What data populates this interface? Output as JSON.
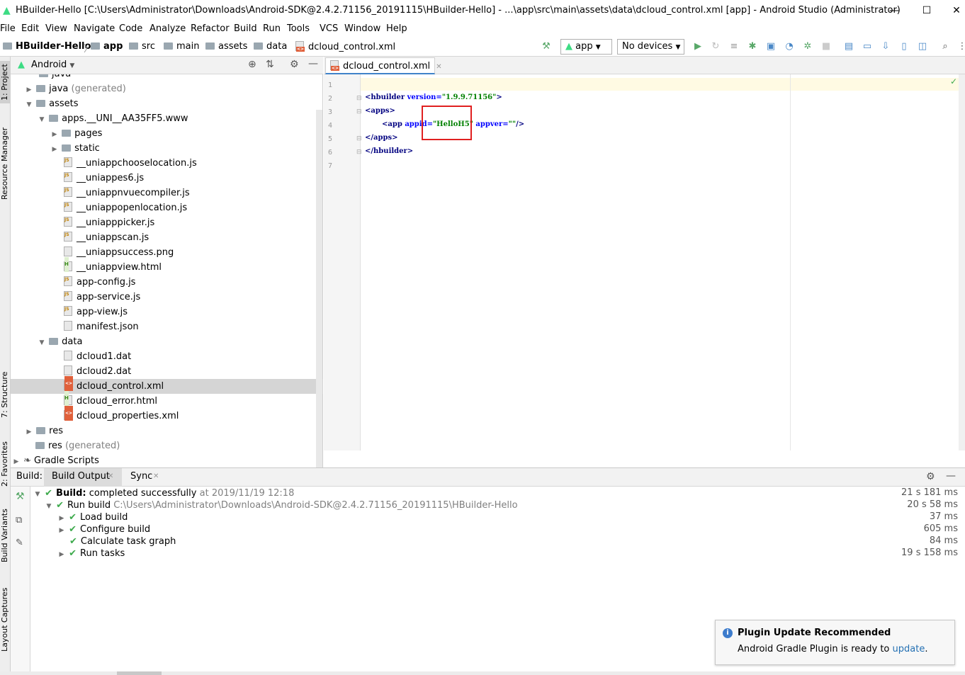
{
  "window": {
    "title": "HBuilder-Hello [C:\\Users\\Administrator\\Downloads\\Android-SDK@2.4.2.71156_20191115\\HBuilder-Hello] - ...\\app\\src\\main\\assets\\data\\dcloud_control.xml [app] - Android Studio (Administrator)",
    "minimize": "—",
    "maximize": "☐",
    "close": "✕"
  },
  "menu": [
    "File",
    "Edit",
    "View",
    "Navigate",
    "Code",
    "Analyze",
    "Refactor",
    "Build",
    "Run",
    "Tools",
    "VCS",
    "Window",
    "Help"
  ],
  "breadcrumb": [
    "HBuilder-Hello",
    "app",
    "src",
    "main",
    "assets",
    "data",
    "dcloud_control.xml"
  ],
  "toolbar": {
    "config": "app",
    "device": "No devices"
  },
  "left_tabs": [
    "1: Project",
    "Resource Manager",
    "7: Structure",
    "2: Favorites",
    "Build Variants",
    "Layout Captures"
  ],
  "project": {
    "view_label": "Android",
    "tree": [
      {
        "label": "java",
        "extra": ""
      },
      {
        "label": "java",
        "extra": "(generated)"
      },
      {
        "label": "assets",
        "extra": ""
      },
      {
        "label": "apps.__UNI__AA35FF5.www",
        "extra": ""
      },
      {
        "label": "pages",
        "extra": ""
      },
      {
        "label": "static",
        "extra": ""
      },
      {
        "label": "__uniappchooselocation.js",
        "extra": ""
      },
      {
        "label": "__uniappes6.js",
        "extra": ""
      },
      {
        "label": "__uniappnvuecompiler.js",
        "extra": ""
      },
      {
        "label": "__uniappopenlocation.js",
        "extra": ""
      },
      {
        "label": "__uniapppicker.js",
        "extra": ""
      },
      {
        "label": "__uniappscan.js",
        "extra": ""
      },
      {
        "label": "__uniappsuccess.png",
        "extra": ""
      },
      {
        "label": "__uniappview.html",
        "extra": ""
      },
      {
        "label": "app-config.js",
        "extra": ""
      },
      {
        "label": "app-service.js",
        "extra": ""
      },
      {
        "label": "app-view.js",
        "extra": ""
      },
      {
        "label": "manifest.json",
        "extra": ""
      },
      {
        "label": "data",
        "extra": ""
      },
      {
        "label": "dcloud1.dat",
        "extra": ""
      },
      {
        "label": "dcloud2.dat",
        "extra": ""
      },
      {
        "label": "dcloud_control.xml",
        "extra": ""
      },
      {
        "label": "dcloud_error.html",
        "extra": ""
      },
      {
        "label": "dcloud_properties.xml",
        "extra": ""
      },
      {
        "label": "res",
        "extra": ""
      },
      {
        "label": "res",
        "extra": "(generated)"
      },
      {
        "label": "Gradle Scripts",
        "extra": ""
      }
    ]
  },
  "editor": {
    "tab_label": "dcloud_control.xml",
    "line_numbers": [
      "1",
      "2",
      "3",
      "4",
      "5",
      "6",
      "7"
    ],
    "code": {
      "l2_tag": "<hbuilder",
      "l2_attr": " version=",
      "l2_val": "\"1.9.9.71156\"",
      "l2_end": ">",
      "l3": "<apps>",
      "l4_tag": "<app",
      "l4_attr1": " appid=",
      "l4_val1": "\"HelloH5\"",
      "l4_attr2": " appver=",
      "l4_val2": "\"\"",
      "l4_end": "/>",
      "l5": "</apps>",
      "l6": "</hbuilder>"
    }
  },
  "build": {
    "label": "Build:",
    "tabs": [
      "Build Output",
      "Sync"
    ],
    "rows": [
      {
        "bold": "Build:",
        "text": "completed successfully",
        "gray": "at 2019/11/19 12:18",
        "time": "21 s 181 ms"
      },
      {
        "bold": "",
        "text": "Run build",
        "gray": "C:\\Users\\Administrator\\Downloads\\Android-SDK@2.4.2.71156_20191115\\HBuilder-Hello",
        "time": "20 s 58 ms"
      },
      {
        "bold": "",
        "text": "Load build",
        "gray": "",
        "time": "37 ms"
      },
      {
        "bold": "",
        "text": "Configure build",
        "gray": "",
        "time": "605 ms"
      },
      {
        "bold": "",
        "text": "Calculate task graph",
        "gray": "",
        "time": "84 ms"
      },
      {
        "bold": "",
        "text": "Run tasks",
        "gray": "",
        "time": "19 s 158 ms"
      }
    ]
  },
  "notification": {
    "title": "Plugin Update Recommended",
    "body": "Android Gradle Plugin is ready to",
    "link": "update",
    "period": "."
  }
}
